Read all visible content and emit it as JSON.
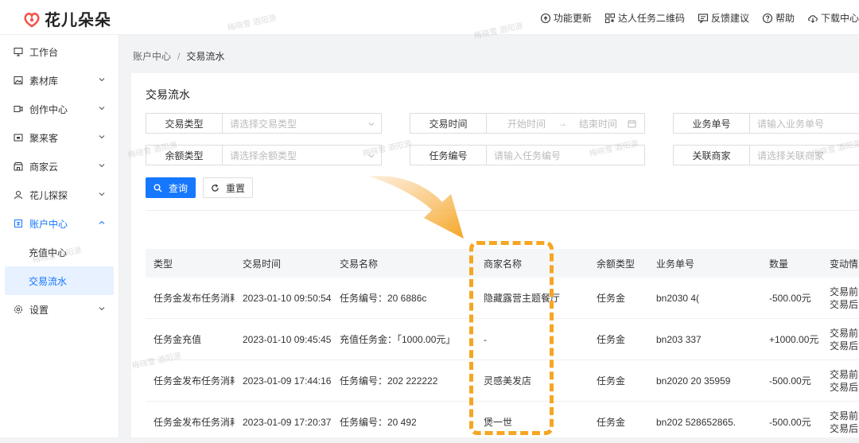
{
  "app": {
    "name": "花儿朵朵",
    "brand_color": "#f5524b",
    "accent_color": "#1677ff",
    "highlight_color": "#f5a623"
  },
  "top_actions": [
    {
      "label": "功能更新",
      "icon": "update-icon"
    },
    {
      "label": "达人任务二维码",
      "icon": "qrcode-icon"
    },
    {
      "label": "反馈建议",
      "icon": "feedback-icon"
    },
    {
      "label": "帮助",
      "icon": "help-icon"
    },
    {
      "label": "下载中心",
      "icon": "download-icon"
    }
  ],
  "sidebar": {
    "items": [
      {
        "label": "工作台",
        "icon": "monitor-icon"
      },
      {
        "label": "素材库",
        "icon": "image-icon"
      },
      {
        "label": "创作中心",
        "icon": "video-icon"
      },
      {
        "label": "聚来客",
        "icon": "store-icon"
      },
      {
        "label": "商家云",
        "icon": "shop-icon"
      },
      {
        "label": "花儿探探",
        "icon": "explore-icon"
      },
      {
        "label": "账户中心",
        "icon": "account-icon"
      },
      {
        "label": "设置",
        "icon": "settings-icon"
      }
    ],
    "sub_items": [
      {
        "label": "充值中心"
      },
      {
        "label": "交易流水"
      }
    ]
  },
  "breadcrumb": {
    "parent": "账户中心",
    "separator": "/",
    "current": "交易流水"
  },
  "page_title": "交易流水",
  "filters": {
    "trade_type": {
      "label": "交易类型",
      "placeholder": "请选择交易类型"
    },
    "trade_time": {
      "label": "交易时间",
      "start": "开始时间",
      "arrow": "→",
      "end": "结束时间"
    },
    "biz_no": {
      "label": "业务单号",
      "placeholder": "请输入业务单号"
    },
    "balance_type": {
      "label": "余额类型",
      "placeholder": "请选择余额类型"
    },
    "task_no": {
      "label": "任务编号",
      "placeholder": "请输入任务编号"
    },
    "merchant": {
      "label": "关联商家",
      "placeholder": "请选择关联商家"
    }
  },
  "buttons": {
    "query": "查询",
    "reset": "重置"
  },
  "table": {
    "headers": [
      "类型",
      "交易时间",
      "交易名称",
      "商家名称",
      "余额类型",
      "业务单号",
      "数量",
      "变动情况"
    ],
    "rows": [
      {
        "type": "任务金发布任务消耗",
        "time": "2023-01-10 09:50:54",
        "name": "任务编号：20          6886c",
        "merchant": "隐藏露营主题餐厅",
        "balance": "任务金",
        "biz_no": "bn2030           4(",
        "amount": "-500.00元",
        "before": "交易前：",
        "after": "交易后："
      },
      {
        "type": "任务金充值",
        "time": "2023-01-10 09:45:45",
        "name": "充值任务金：「1000.00元」",
        "merchant": "-",
        "balance": "任务金",
        "biz_no": "bn203           337",
        "amount": "+1000.00元",
        "before": "交易前：",
        "after": "交易后："
      },
      {
        "type": "任务金发布任务消耗",
        "time": "2023-01-09 17:44:16",
        "name": "任务编号：202          222222",
        "merchant": "灵感美发店",
        "balance": "任务金",
        "biz_no": "bn2020  20   35959",
        "amount": "-500.00元",
        "before": "交易前：",
        "after": "交易后："
      },
      {
        "type": "任务金发布任务消耗",
        "time": "2023-01-09 17:20:37",
        "name": "任务编号：20           492",
        "merchant": "煲一世",
        "balance": "任务金",
        "biz_no": "bn202    528652865.",
        "amount": "-500.00元",
        "before": "交易前：",
        "after": "交易后："
      }
    ]
  },
  "watermark": "梅晓雪 酒阳源"
}
